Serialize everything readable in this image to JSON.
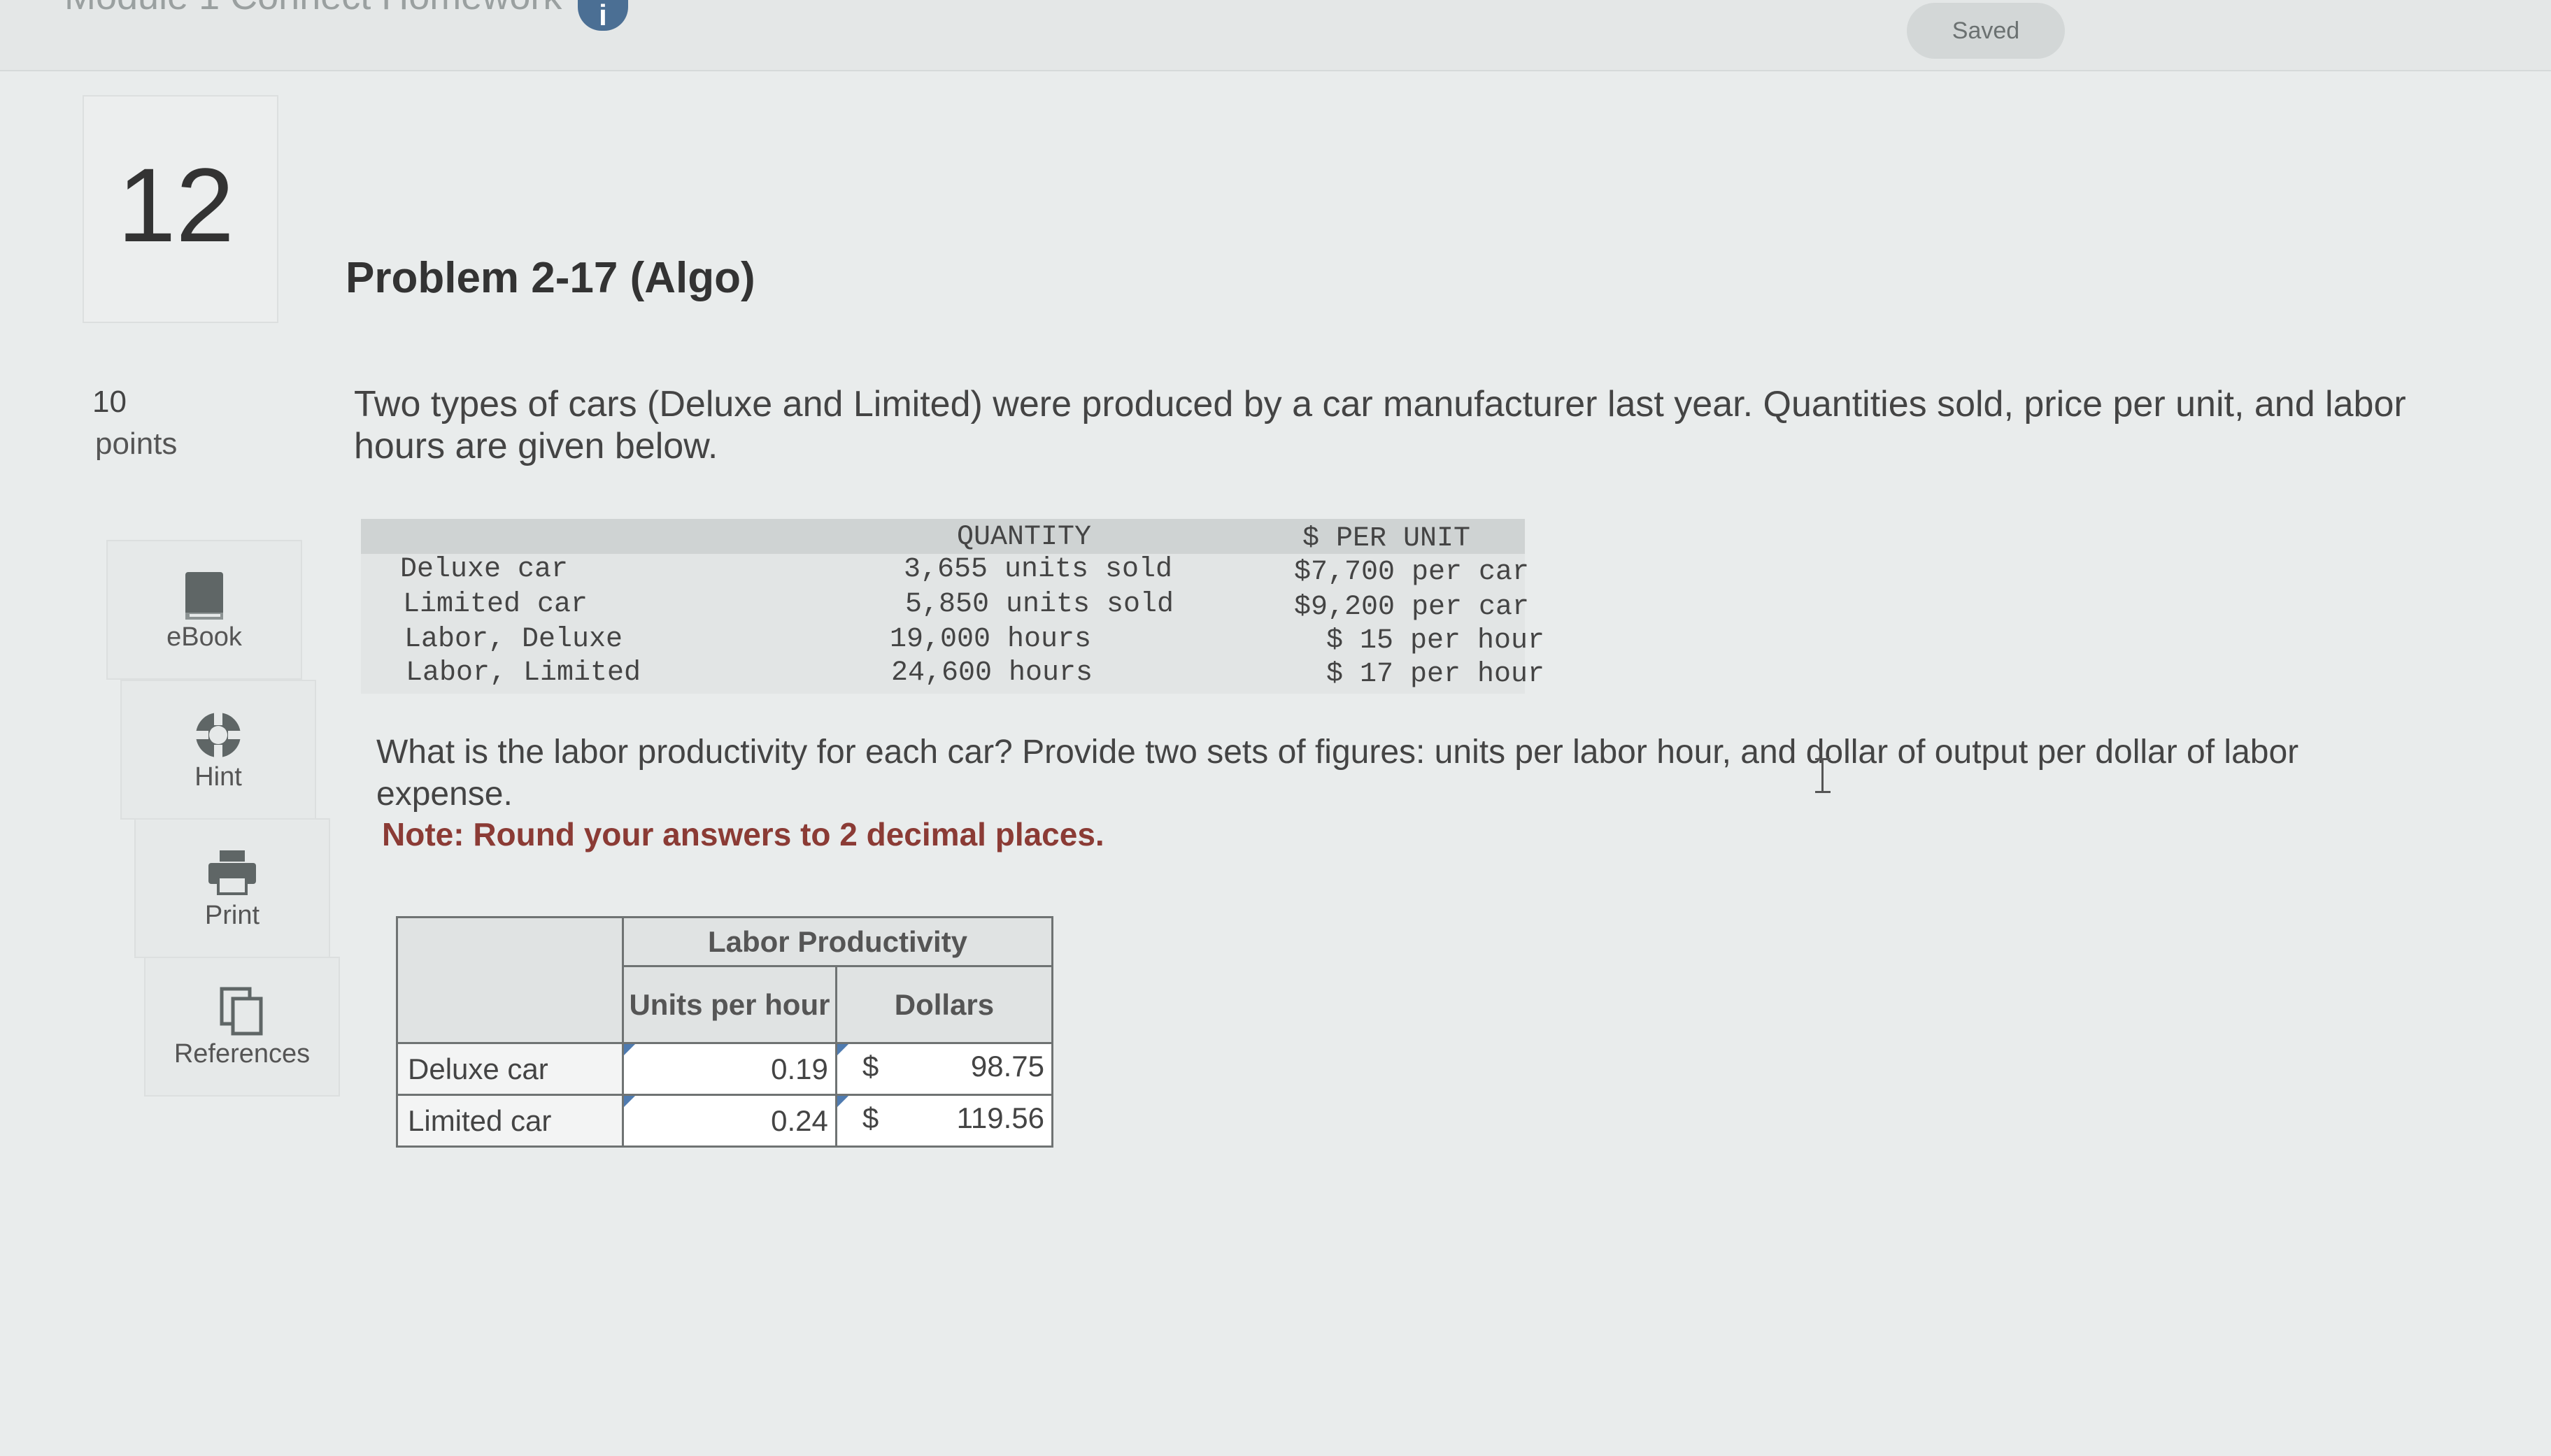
{
  "header": {
    "module_title": "Module 1 Connect Homework",
    "info_badge": "i",
    "saved_label": "Saved"
  },
  "question": {
    "number": "12",
    "title": "Problem 2-17 (Algo)",
    "points_value": "10",
    "points_label": "points"
  },
  "side_tools": [
    {
      "label": "eBook",
      "icon": "book-icon"
    },
    {
      "label": "Hint",
      "icon": "lifebuoy-icon"
    },
    {
      "label": "Print",
      "icon": "printer-icon"
    },
    {
      "label": "References",
      "icon": "documents-icon"
    }
  ],
  "intro_text": "Two types of cars (Deluxe and Limited) were produced by a car manufacturer last year. Quantities sold, price per unit, and labor hours are given below.",
  "data_table": {
    "headers": {
      "quantity": "QUANTITY",
      "per_unit": "$ PER UNIT"
    },
    "rows": [
      {
        "label": "Deluxe car",
        "quantity": "3,655 units sold",
        "per_unit": "$7,700 per car"
      },
      {
        "label": "Limited car",
        "quantity": "5,850 units sold",
        "per_unit": "$9,200 per car"
      },
      {
        "label": "Labor, Deluxe",
        "quantity": "19,000 hours",
        "per_unit": "$ 15 per hour"
      },
      {
        "label": "Labor, Limited",
        "quantity": "24,600 hours",
        "per_unit": "$ 17 per hour"
      }
    ]
  },
  "question_text": "What is the labor productivity for each car? Provide two sets of figures: units per labor hour, and dollar of output per dollar of labor expense.",
  "note_text": "Note: Round your answers to 2 decimal places.",
  "answer_table": {
    "group_header": "Labor Productivity",
    "col_units": "Units per hour",
    "col_dollars": "Dollars",
    "currency": "$",
    "rows": [
      {
        "label": "Deluxe car",
        "units": "0.19",
        "dollars": "98.75"
      },
      {
        "label": "Limited car",
        "units": "0.24",
        "dollars": "119.56"
      }
    ]
  }
}
